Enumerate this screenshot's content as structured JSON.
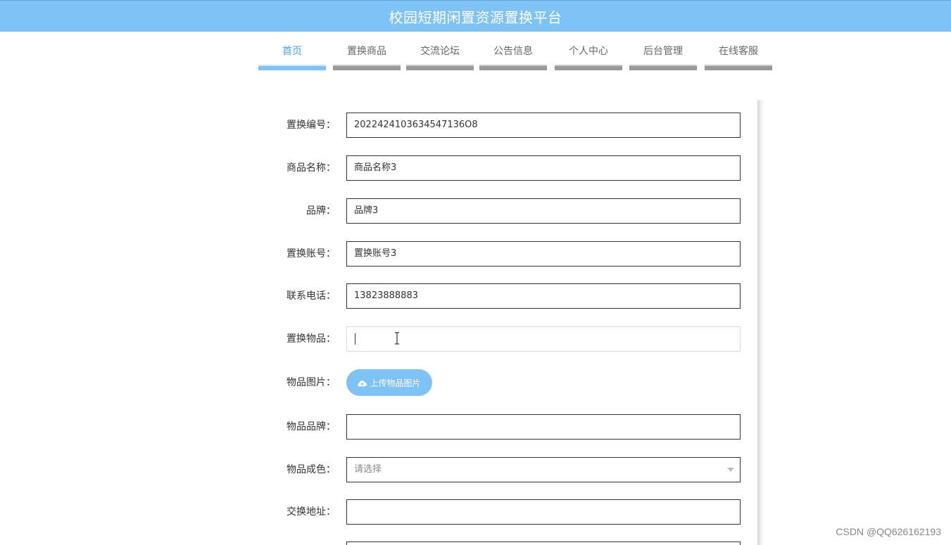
{
  "header": {
    "title": "校园短期闲置资源置换平台"
  },
  "nav": {
    "items": [
      {
        "label": "首页",
        "active": true
      },
      {
        "label": "置换商品"
      },
      {
        "label": "交流论坛"
      },
      {
        "label": "公告信息"
      },
      {
        "label": "个人中心"
      },
      {
        "label": "后台管理"
      },
      {
        "label": "在线客服"
      }
    ]
  },
  "form": {
    "exchange_no": {
      "label": "置换编号：",
      "value": "2022424103634547136O8"
    },
    "product_name": {
      "label": "商品名称：",
      "value": "商品名称3"
    },
    "brand": {
      "label": "品牌：",
      "value": "品牌3"
    },
    "exchange_account": {
      "label": "置换账号：",
      "value": "置换账号3"
    },
    "phone": {
      "label": "联系电话：",
      "value": "13823888883"
    },
    "exchange_item": {
      "label": "置换物品：",
      "value": ""
    },
    "item_image": {
      "label": "物品图片：",
      "button": "上传物品图片"
    },
    "item_brand": {
      "label": "物品品牌：",
      "value": ""
    },
    "item_condition": {
      "label": "物品成色：",
      "placeholder": "请选择"
    },
    "exchange_address": {
      "label": "交换地址：",
      "value": ""
    }
  },
  "watermark": "CSDN @QQ626162193",
  "colors": {
    "accent": "#7fc2f5",
    "nav_active": "#4aa3e8"
  }
}
